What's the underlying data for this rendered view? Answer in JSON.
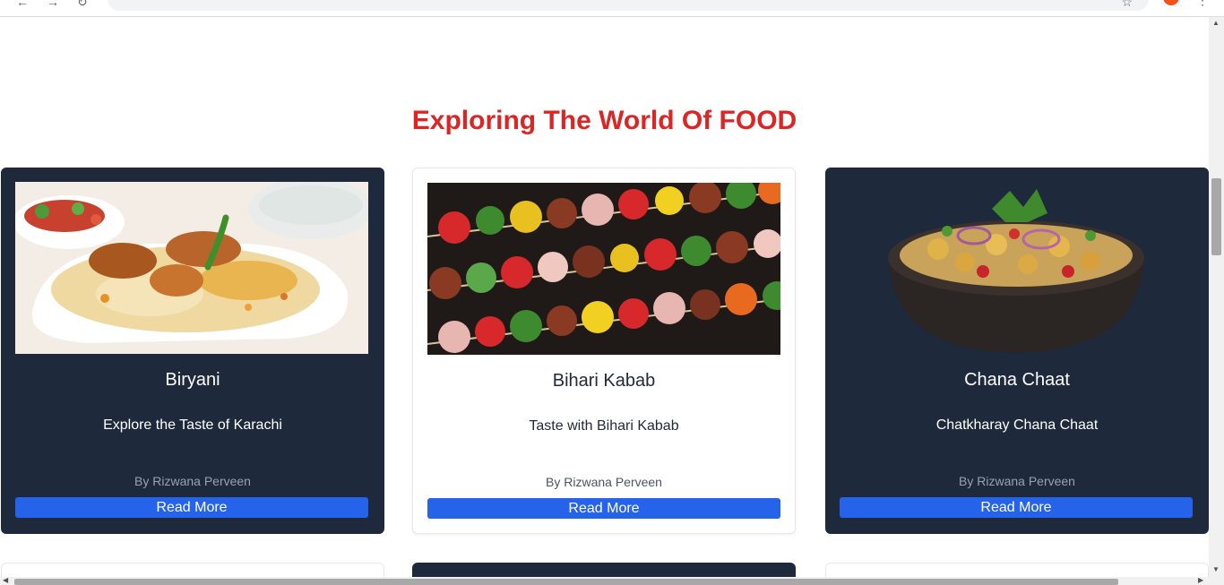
{
  "page": {
    "title": "Exploring The World Of FOOD",
    "title_color": "#dc2626"
  },
  "cards": [
    {
      "name": "Biryani",
      "subtitle": "Explore the Taste of Karachi",
      "author": "By Rizwana Perveen",
      "button": "Read More",
      "theme": "dark",
      "image": "biryani-photo"
    },
    {
      "name": "Bihari Kabab",
      "subtitle": "Taste with Bihari Kabab",
      "author": "By Rizwana Perveen",
      "button": "Read More",
      "theme": "light",
      "image": "kabab-skewers-photo"
    },
    {
      "name": "Chana Chaat",
      "subtitle": "Chatkharay Chana Chaat",
      "author": "By Rizwana Perveen",
      "button": "Read More",
      "theme": "dark",
      "image": "chana-chaat-photo"
    }
  ],
  "colors": {
    "card_dark": "#1e293b",
    "button": "#2563eb",
    "accent_title": "#dc2626"
  },
  "icons": {
    "back": "arrow-left-icon",
    "forward": "arrow-right-icon",
    "reload": "reload-icon",
    "bookmark": "star-icon",
    "menu": "kebab-menu-icon"
  }
}
